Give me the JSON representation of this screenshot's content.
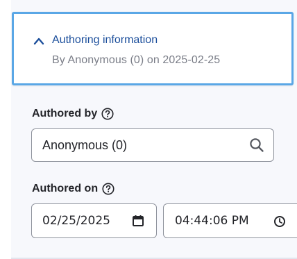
{
  "authoring": {
    "summary_title": "Authoring information",
    "summary_subtitle": "By Anonymous (0) on 2025-02-25",
    "expanded": true
  },
  "authored_by": {
    "label": "Authored by",
    "value": "Anonymous (0)",
    "help_icon": "question-circle-icon",
    "search_icon": "search-icon"
  },
  "authored_on": {
    "label": "Authored on",
    "date_value": "02/25/2025",
    "time_value": "04:44:06 PM",
    "help_icon": "question-circle-icon",
    "calendar_icon": "calendar-icon",
    "clock_icon": "clock-icon"
  },
  "colors": {
    "accent": "#1b4e9b",
    "focus_border": "#5aa7e6",
    "panel_background": "#f7f8fc",
    "input_border": "#8e929c"
  }
}
